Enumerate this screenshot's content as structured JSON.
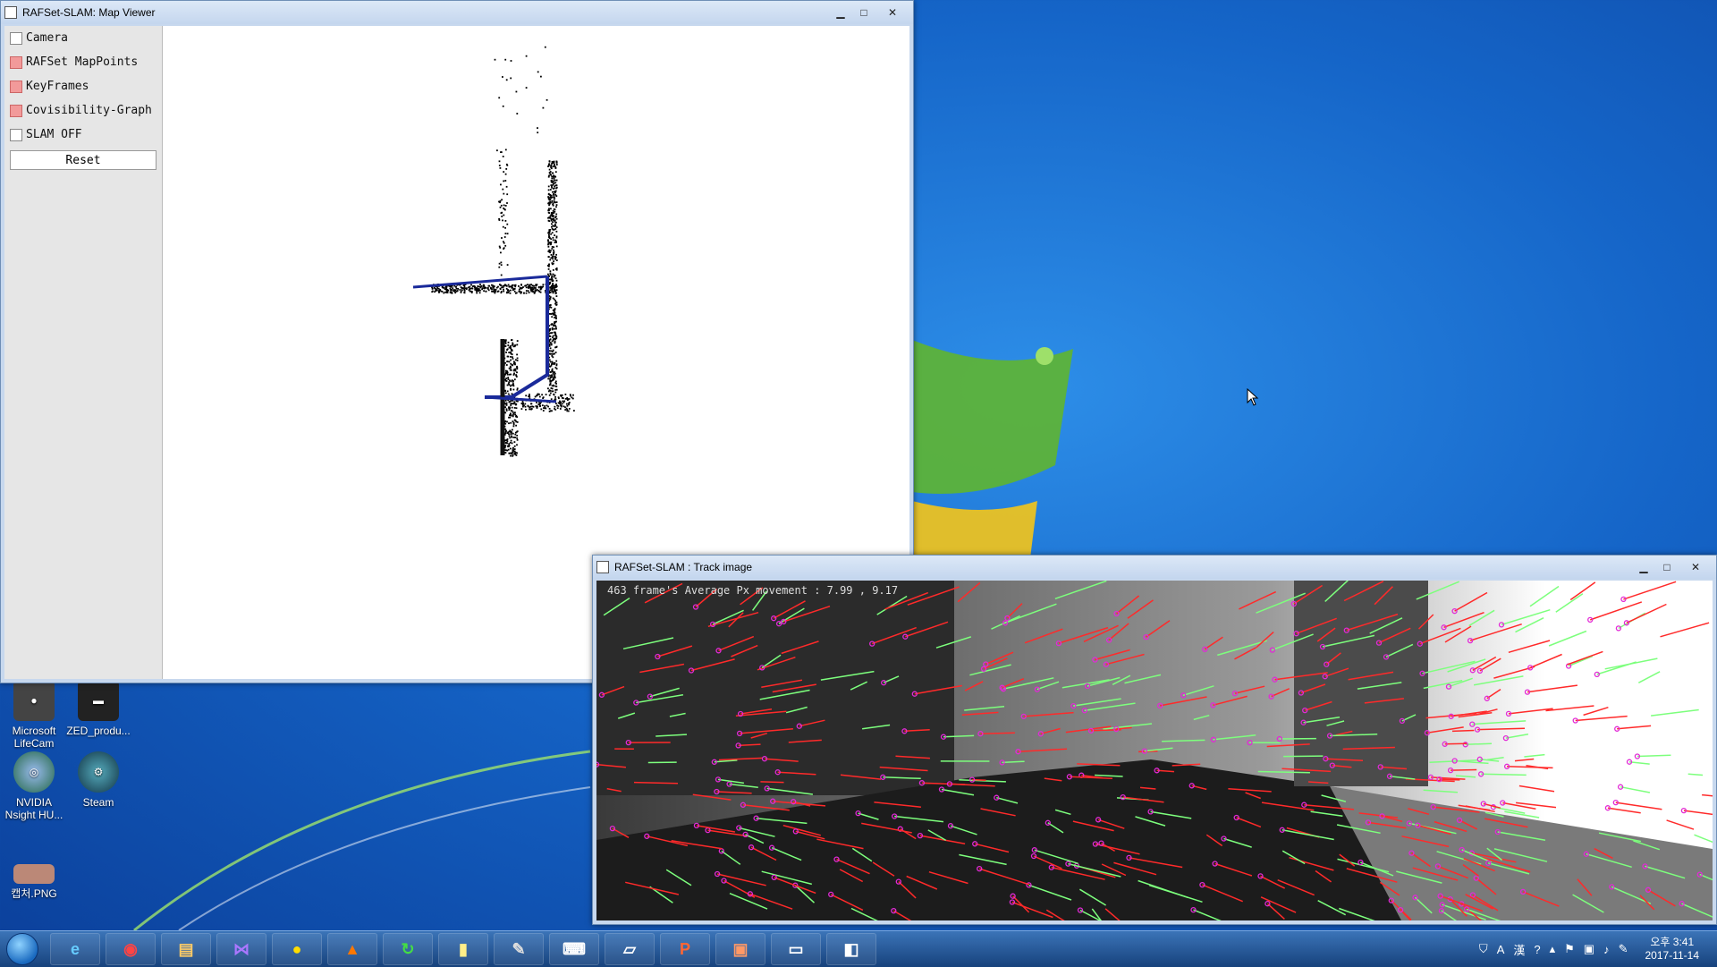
{
  "map_viewer": {
    "title": "RAFSet-SLAM: Map Viewer",
    "options": [
      {
        "label": "Camera",
        "checked": false
      },
      {
        "label": "RAFSet MapPoints",
        "checked": true
      },
      {
        "label": "KeyFrames",
        "checked": true
      },
      {
        "label": "Covisibility-Graph",
        "checked": true
      },
      {
        "label": "SLAM OFF",
        "checked": false
      }
    ],
    "reset_label": "Reset"
  },
  "track_window": {
    "title": "RAFSet-SLAM : Track image",
    "overlay": "463 frame's Average Px movement : 7.99 , 9.17"
  },
  "desktop_icons": [
    {
      "label": "Microsoft LifeCam",
      "icon": "webcam-icon"
    },
    {
      "label": "ZED_produ...",
      "icon": "zed-camera-icon"
    },
    {
      "label": "NVIDIA Nsight HU...",
      "icon": "nvidia-icon"
    },
    {
      "label": "Steam",
      "icon": "steam-icon"
    },
    {
      "label": "캡처.PNG",
      "icon": "image-file-icon"
    }
  ],
  "taskbar": {
    "apps": [
      "ie",
      "chrome",
      "explorer",
      "visual-studio",
      "kakaotalk",
      "matlab",
      "app-green",
      "sticky-notes",
      "paint",
      "hotkey",
      "tablet",
      "powerpoint",
      "photos",
      "cmd",
      "window"
    ],
    "tray": {
      "ime_a": "A",
      "ime_han": "漢",
      "time": "오후 3:41",
      "date": "2017-11-14"
    }
  },
  "colors": {
    "desktop_blue": "#1565c8",
    "match_red": "#ff2a2a",
    "match_green": "#7dff7d",
    "keypoint_magenta": "#e22ad6"
  }
}
